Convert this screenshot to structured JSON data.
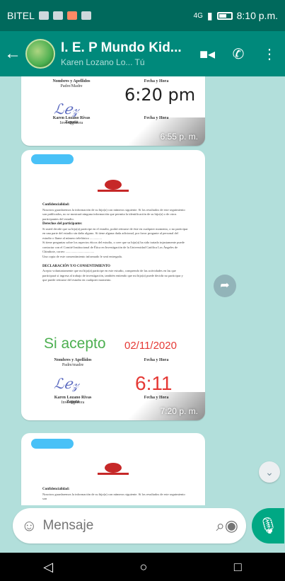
{
  "status_bar": {
    "carrier": "BITEL",
    "signal": "4G",
    "time": "8:10 p.m."
  },
  "header": {
    "back_icon": "arrow-left-icon",
    "title": "I. E. P Mundo Kid...",
    "subtitle": "Karen Lozano Lo... Tú",
    "video_icon": "video-call-icon",
    "call_icon": "phone-icon",
    "menu_icon": "more-vertical-icon"
  },
  "messages": [
    {
      "doc": {
        "label_name": "Nombres y Apellidos",
        "label_parent": "Padre/Madre",
        "label_date": "Fecha y Hora",
        "signer_name": "Karen Lozano Rivas Zapata",
        "signer_role": "Investigadora",
        "handwritten_time": "6:20 pm"
      },
      "time": "6:55 p. m."
    },
    {
      "doc": {
        "heading": "Confidencialidad:",
        "p1": "Nosotros guardaremos la información de su hijo(a) con números siguiente. Si los resultados de este seguimiento son publicados, no se mostrará ninguna información que permita la identificación de su hijo(a) o de otros participantes del estudio.",
        "h2": "Derechos del participante:",
        "p2": "Si usted decide que su hijo(a) participe en el estudio, podrá retirarse de éste en cualquier momento, o no participar en una parte del estudio sin daño alguno. Si tiene alguna duda adicional, por favor pregunte al personal del estudio o llame al número telefónico ...............",
        "p3": "Si tiene preguntas sobre los aspectos éticos del estudio, o cree que su hijo(a) ha sido tratado injustamente puede contactar con el Comité Institucional de Ética en Investigación de la Universidad Católica Los Ángeles de Chimbote, correo ....................................",
        "p4": "Una copia de este consentimiento informado le será entregada.",
        "h3": "DECLARACIÓN Y/O CONSENTIMIENTO",
        "p5": "Acepto voluntariamente que mi hijo(a) participe en este estudio, comprendo de las actividades en las que participará si ingresa al trabajo de investigación, también entiendo que mi hijo(a) puede decidir no participar y que puede retirarse del estudio en cualquier momento.",
        "handwritten_accept": "Si acepto",
        "handwritten_date": "02/11/2020",
        "label_name": "Nombres y Apellidos",
        "label_parent": "Padre/madre",
        "label_date": "Fecha y Hora",
        "signer_name": "Karen Lozano Rivas Zapata",
        "signer_role": "Investigadora",
        "handwritten_time": "6:11"
      },
      "time": "7:20 p. m."
    },
    {
      "doc": {
        "heading": "Confidencialidad:",
        "p1": "Nosotros guardaremos la información de su hijo(a) con números siguiente. Si los resultados de este seguimiento son"
      }
    }
  ],
  "input": {
    "placeholder": "Mensaje",
    "emoji_icon": "emoji-icon",
    "attach_icon": "paperclip-icon",
    "camera_icon": "camera-icon",
    "mic_icon": "microphone-icon"
  },
  "colors": {
    "header": "#00897b",
    "status_bar": "#00695c",
    "chat_bg": "#b2dfdb",
    "accent": "#00a884",
    "handwriting_green": "#4caf50",
    "handwriting_red": "#e53935"
  }
}
